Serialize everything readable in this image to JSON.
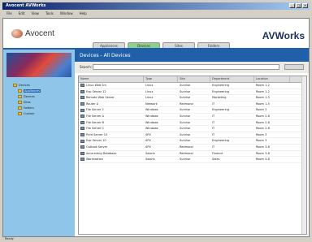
{
  "window": {
    "title": "Avocent AVWorks"
  },
  "menu": [
    "File",
    "Edit",
    "View",
    "Tools",
    "Window",
    "Help"
  ],
  "header": {
    "logo_text": "Avocent",
    "brand": "AVWorks"
  },
  "tabs": [
    {
      "label": "Appliances",
      "active": false
    },
    {
      "label": "Devices",
      "active": true
    },
    {
      "label": "Sites",
      "active": false
    },
    {
      "label": "Folders",
      "active": false
    }
  ],
  "sidebar": {
    "tree": [
      {
        "label": "Devices",
        "selected": false,
        "child": false
      },
      {
        "label": "Appliances",
        "selected": true,
        "child": true
      },
      {
        "label": "Devices",
        "selected": false,
        "child": true
      },
      {
        "label": "Sites",
        "selected": false,
        "child": true
      },
      {
        "label": "Folders",
        "selected": false,
        "child": true
      },
      {
        "label": "Custom",
        "selected": false,
        "child": true
      }
    ]
  },
  "main": {
    "title": "Devices - All Devices",
    "search_label": "Search:",
    "search_value": "",
    "columns": [
      "Name",
      "Type",
      "Site",
      "Department",
      "Location"
    ],
    "rows": [
      [
        "Linux Web Srv",
        "Linux",
        "Sunrise",
        "Engineering",
        "Room 1-2"
      ],
      [
        "Exp Server 12",
        "Linux",
        "Sunrise",
        "Engineering",
        "Room 1-2"
      ],
      [
        "Remote Web Server",
        "Linux",
        "Sunrise",
        "Marketing",
        "Room 1-3"
      ],
      [
        "Router A",
        "Network",
        "Redmond",
        "IT",
        "Room 1-5"
      ],
      [
        "File Server 2",
        "Windows",
        "Sunrise",
        "Engineering",
        "Room 2"
      ],
      [
        "File Server A",
        "Windows",
        "Sunrise",
        "IT",
        "Room 2-6"
      ],
      [
        "File Server B",
        "Windows",
        "Sunrise",
        "IT",
        "Room 2-6"
      ],
      [
        "File Server C",
        "Windows",
        "Sunrise",
        "IT",
        "Room 2-6"
      ],
      [
        "Print Server 10",
        "SPX",
        "Sunrise",
        "IT",
        "Room 3"
      ],
      [
        "Exp Server 10",
        "SPX",
        "Sunrise",
        "Engineering",
        "Room 3"
      ],
      [
        "Outlook Server",
        "SPX",
        "Redmond",
        "IT",
        "Room 3-8"
      ],
      [
        "Accounting Database",
        "Solaris",
        "Redmond",
        "Finance",
        "Room 3-8"
      ],
      [
        "Workstation",
        "Solaris",
        "Sunrise",
        "Sales",
        "Room 4-8"
      ]
    ]
  },
  "status": {
    "text": "Ready"
  }
}
